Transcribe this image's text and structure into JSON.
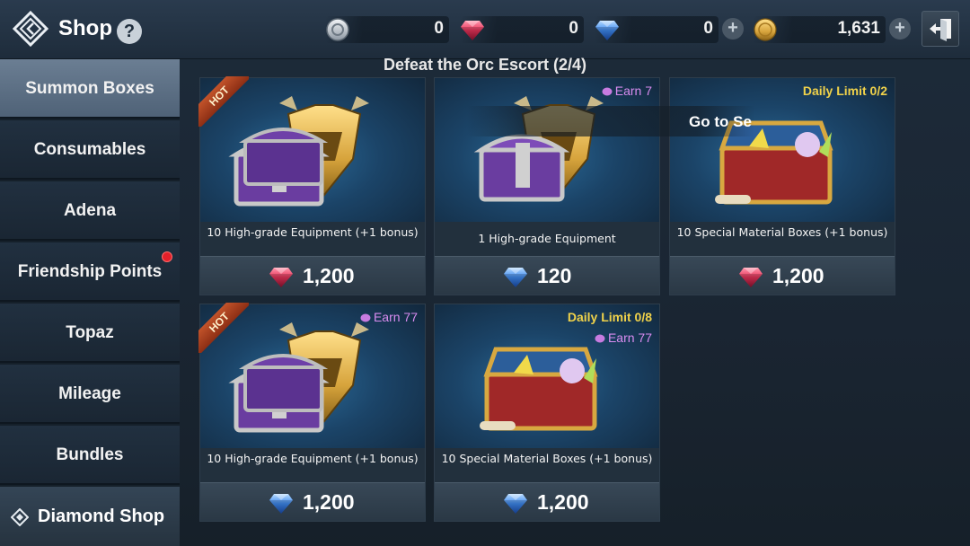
{
  "header": {
    "title": "Shop",
    "help_label": "?",
    "currencies": [
      {
        "name": "silver-token",
        "value": "0"
      },
      {
        "name": "red-diamond",
        "value": "0"
      },
      {
        "name": "blue-diamond",
        "value": "0"
      },
      {
        "name": "adena-coin",
        "value": "1,631"
      }
    ],
    "plus_label": "+"
  },
  "sidebar": {
    "items": [
      {
        "label": "Summon Boxes",
        "active": true
      },
      {
        "label": "Consumables"
      },
      {
        "label": "Adena"
      },
      {
        "label": "Friendship Points",
        "notification": true
      },
      {
        "label": "Topaz"
      },
      {
        "label": "Mileage"
      },
      {
        "label": "Bundles"
      }
    ],
    "diamond_shop_label": "Diamond Shop"
  },
  "quest": {
    "text": "Defeat the Orc Escort (2/4)",
    "goto_text": "Go to Se"
  },
  "cards": [
    {
      "name": "10 High-grade Equipment (+1 bonus)",
      "price": "1,200",
      "currency": "red-diamond",
      "hot": "HOT",
      "art": "equipment"
    },
    {
      "name": "1 High-grade Equipment",
      "price": "120",
      "currency": "blue-diamond",
      "earn": "Earn 7",
      "art": "equipment"
    },
    {
      "name": "10 Special Material Boxes (+1 bonus)",
      "price": "1,200",
      "currency": "red-diamond",
      "limit": "Daily Limit 0/2",
      "art": "material"
    },
    {
      "name": "10 High-grade Equipment (+1 bonus)",
      "price": "1,200",
      "currency": "blue-diamond",
      "hot": "HOT",
      "earn": "Earn 77",
      "art": "equipment"
    },
    {
      "name": "10 Special Material Boxes (+1 bonus)",
      "price": "1,200",
      "currency": "blue-diamond",
      "limit": "Daily Limit 0/8",
      "earn": "Earn 77",
      "art": "material"
    }
  ],
  "colors": {
    "red_diamond": "#e8335a",
    "blue_diamond": "#3f8bf0",
    "earn": "#d98cf0",
    "limit": "#f0d24a",
    "hot": "#b44420"
  }
}
